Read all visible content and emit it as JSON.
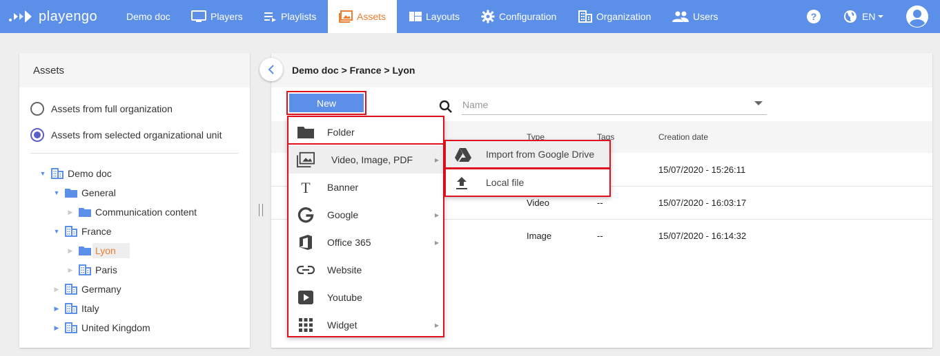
{
  "brand": {
    "name": "playengo"
  },
  "nav": {
    "items": [
      {
        "label": "Demo doc",
        "icon": "none"
      },
      {
        "label": "Players",
        "icon": "monitor-icon"
      },
      {
        "label": "Playlists",
        "icon": "playlist-icon"
      },
      {
        "label": "Assets",
        "icon": "image-icon",
        "active": true
      },
      {
        "label": "Layouts",
        "icon": "layout-icon"
      },
      {
        "label": "Configuration",
        "icon": "gear-icon"
      },
      {
        "label": "Organization",
        "icon": "building-icon"
      },
      {
        "label": "Users",
        "icon": "people-icon"
      }
    ],
    "language": "EN"
  },
  "assets_panel": {
    "title": "Assets",
    "scope_options": [
      {
        "label": "Assets from full organization",
        "selected": false
      },
      {
        "label": "Assets from selected organizational unit",
        "selected": true
      }
    ],
    "tree": [
      {
        "label": "Demo doc",
        "level": 0,
        "expanded": true,
        "type": "organization"
      },
      {
        "label": "General",
        "level": 1,
        "expanded": true,
        "type": "folder"
      },
      {
        "label": "Communication content",
        "level": 2,
        "expanded": false,
        "type": "folder"
      },
      {
        "label": "France",
        "level": 1,
        "expanded": true,
        "type": "organization"
      },
      {
        "label": "Lyon",
        "level": 2,
        "expanded": false,
        "type": "folder",
        "selected": true
      },
      {
        "label": "Paris",
        "level": 2,
        "expanded": false,
        "type": "organization"
      },
      {
        "label": "Germany",
        "level": 1,
        "expanded": false,
        "type": "organization"
      },
      {
        "label": "Italy",
        "level": 1,
        "expanded": false,
        "type": "organization"
      },
      {
        "label": "United Kingdom",
        "level": 1,
        "expanded": false,
        "type": "organization"
      }
    ]
  },
  "content": {
    "breadcrumb": "Demo doc > France > Lyon",
    "new_button": "New",
    "search": {
      "placeholder": "Name",
      "value": ""
    },
    "table": {
      "columns": [
        "Type",
        "Tags",
        "Creation date"
      ],
      "rows": [
        {
          "type": "",
          "tags": "",
          "creation_date": "15/07/2020 - 15:26:11"
        },
        {
          "type": "Video",
          "tags": "--",
          "creation_date": "15/07/2020 - 16:03:17"
        },
        {
          "type": "Image",
          "tags": "--",
          "creation_date": "15/07/2020 - 16:14:32"
        }
      ]
    }
  },
  "new_menu": {
    "items": [
      {
        "label": "Folder",
        "icon": "folder-icon",
        "submenu": false
      },
      {
        "label": "Video, Image, PDF",
        "icon": "media-icon",
        "submenu": true,
        "highlighted": true
      },
      {
        "label": "Banner",
        "icon": "text-icon",
        "submenu": false
      },
      {
        "label": "Google",
        "icon": "google-icon",
        "submenu": true
      },
      {
        "label": "Office 365",
        "icon": "office-icon",
        "submenu": true
      },
      {
        "label": "Website",
        "icon": "link-icon",
        "submenu": false
      },
      {
        "label": "Youtube",
        "icon": "youtube-icon",
        "submenu": false
      },
      {
        "label": "Widget",
        "icon": "grid-icon",
        "submenu": true
      }
    ]
  },
  "import_submenu": {
    "items": [
      {
        "label": "Import from Google Drive",
        "icon": "google-drive-icon"
      },
      {
        "label": "Local file",
        "icon": "upload-icon"
      }
    ]
  },
  "colors": {
    "topbar": "#5b8fe8",
    "accent_orange": "#f07c30",
    "highlight_red": "#e0101e",
    "radio_selected": "#5b5fc7"
  }
}
